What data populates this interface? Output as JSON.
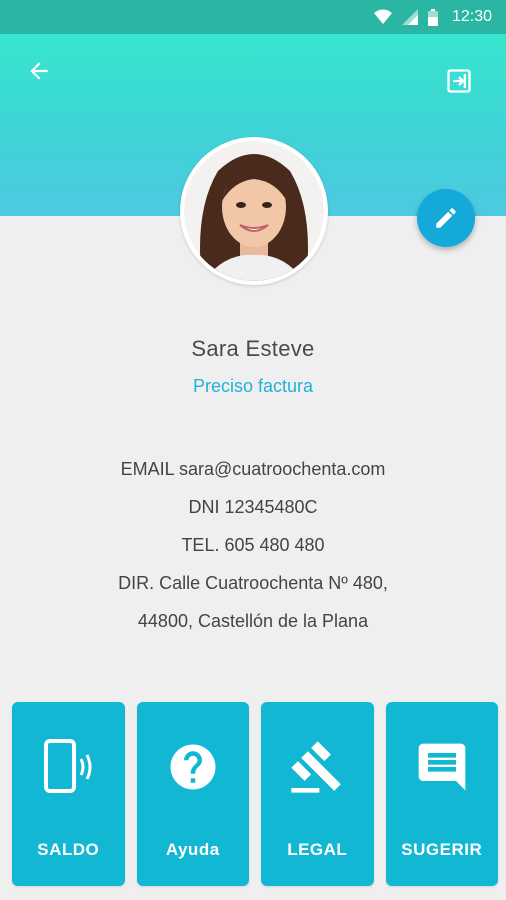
{
  "status_bar": {
    "time": "12:30"
  },
  "profile": {
    "name": "Sara Esteve",
    "invoice_link": "Preciso factura"
  },
  "info": {
    "email": "EMAIL sara@cuatroochenta.com",
    "dni": "DNI 12345480C",
    "tel": "TEL. 605 480 480",
    "dir_line1": "DIR. Calle Cuatroochenta Nº 480,",
    "dir_line2": "44800, Castellón de la Plana"
  },
  "tiles": [
    {
      "label": "SALDO",
      "icon": "phone-vibrate-icon"
    },
    {
      "label": "Ayuda",
      "icon": "help-icon"
    },
    {
      "label": "LEGAL",
      "icon": "gavel-icon"
    },
    {
      "label": "SUGERIR",
      "icon": "feedback-icon"
    }
  ],
  "colors": {
    "header_top": "#36e6cf",
    "header_bottom": "#4ec9e0",
    "accent": "#1fb2dc",
    "tile": "#12b7d4",
    "fab": "#14a9d8"
  }
}
